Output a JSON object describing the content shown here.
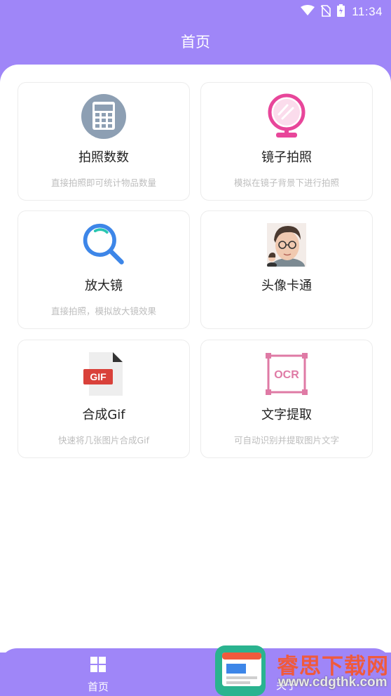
{
  "status_bar": {
    "time": "11:34",
    "icons": [
      "wifi-icon",
      "no-sim-icon",
      "battery-charging-icon"
    ]
  },
  "header": {
    "title": "首页"
  },
  "cards": [
    {
      "title": "拍照数数",
      "desc": "直接拍照即可统计物品数量",
      "icon": "calculator-icon"
    },
    {
      "title": "镜子拍照",
      "desc": "模拟在镜子背景下进行拍照",
      "icon": "mirror-icon"
    },
    {
      "title": "放大镜",
      "desc": "直接拍照，模拟放大镜效果",
      "icon": "magnifier-icon"
    },
    {
      "title": "头像卡通",
      "desc": "",
      "icon": "cartoon-avatar-icon"
    },
    {
      "title": "合成Gif",
      "desc": "快速将几张图片合成Gif",
      "icon": "gif-file-icon"
    },
    {
      "title": "文字提取",
      "desc": "可自动识别并提取图片文字",
      "icon": "ocr-icon"
    }
  ],
  "bottom_nav": {
    "home_label": "首页",
    "about_label": "关于"
  },
  "watermark": {
    "title": "睿思下载网",
    "url": "www.cdgthk.com"
  },
  "colors": {
    "brand": "#9f86f8",
    "accent_pink": "#e8469a",
    "accent_blue": "#3d86e8",
    "ocr_pink": "#df7aa5",
    "gif_red": "#d9413a"
  }
}
